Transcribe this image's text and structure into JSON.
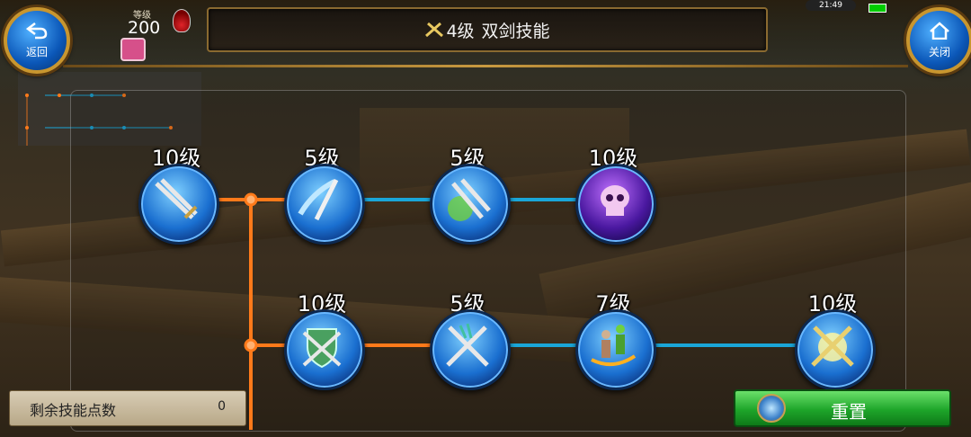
{
  "header": {
    "title_tag": "4级",
    "title": "双剑技能",
    "back_label": "返回",
    "close_label": "关闭"
  },
  "player": {
    "level_caption": "等级",
    "level_value": "200"
  },
  "status": {
    "clock": "21:49"
  },
  "skills": [
    {
      "req": "10级",
      "icon": "crossed-swords-icon",
      "branch": 1,
      "col": 0
    },
    {
      "req": "5级",
      "icon": "sword-slash-icon",
      "branch": 1,
      "col": 1
    },
    {
      "req": "5级",
      "icon": "twin-swords-icon",
      "branch": 1,
      "col": 2
    },
    {
      "req": "10级",
      "icon": "skull-icon",
      "branch": 1,
      "col": 3
    },
    {
      "req": "10级",
      "icon": "shield-swords-icon",
      "branch": 2,
      "col": 1
    },
    {
      "req": "5级",
      "icon": "crossed-blades-icon",
      "branch": 2,
      "col": 2
    },
    {
      "req": "7级",
      "icon": "figures-swap-icon",
      "branch": 2,
      "col": 3
    },
    {
      "req": "10级",
      "icon": "golden-swords-icon",
      "branch": 2,
      "col": 4
    }
  ],
  "footer": {
    "points_label": "剩余技能点数",
    "points_value": "0",
    "reset_label": "重置"
  },
  "colors": {
    "orange_link": "#ff7a1a",
    "blue_link": "#1aa6d8",
    "reset_green": "#1ea52a"
  }
}
